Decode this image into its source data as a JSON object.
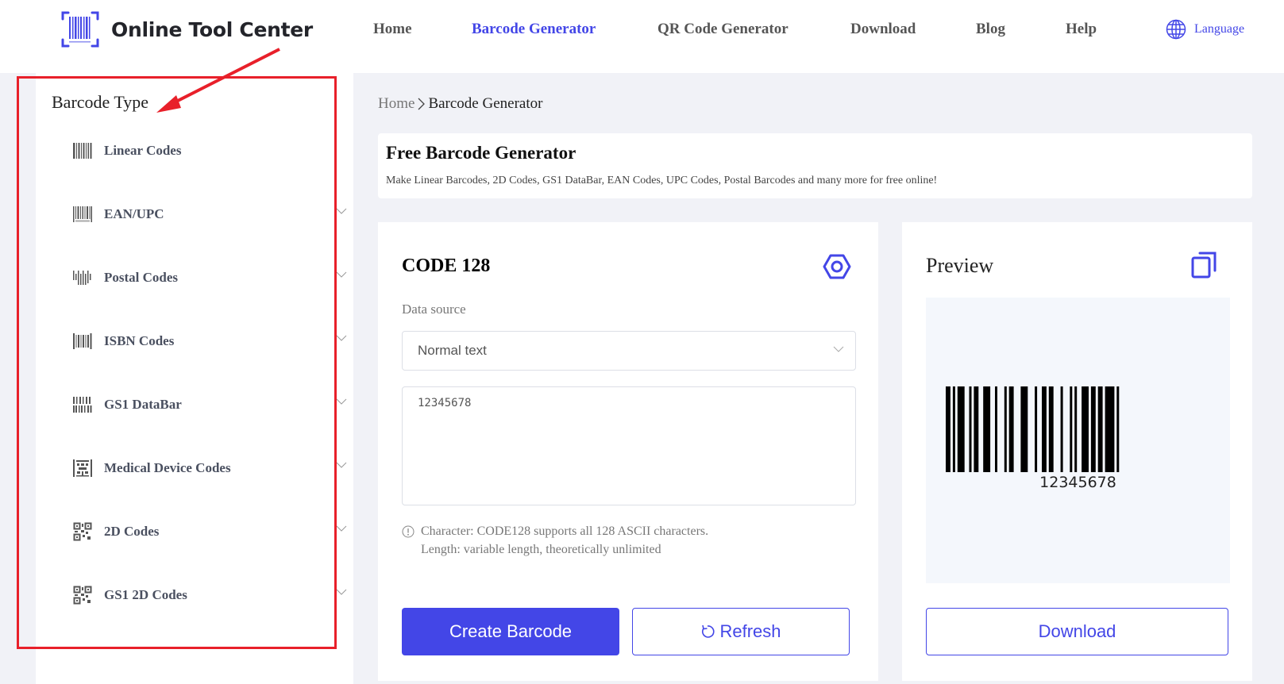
{
  "header": {
    "brand": "Online Tool Center",
    "nav": [
      {
        "label": "Home",
        "active": false
      },
      {
        "label": "Barcode Generator",
        "active": true
      },
      {
        "label": "QR Code Generator",
        "active": false
      },
      {
        "label": "Download",
        "active": false
      },
      {
        "label": "Blog",
        "active": false
      },
      {
        "label": "Help",
        "active": false
      }
    ],
    "language_label": "Language"
  },
  "sidebar": {
    "title": "Barcode Type",
    "items": [
      {
        "label": "Linear Codes",
        "icon": "linear-barcode-icon",
        "expandable": false
      },
      {
        "label": "EAN/UPC",
        "icon": "ean-upc-icon",
        "expandable": true
      },
      {
        "label": "Postal Codes",
        "icon": "postal-barcode-icon",
        "expandable": true
      },
      {
        "label": "ISBN Codes",
        "icon": "isbn-barcode-icon",
        "expandable": true
      },
      {
        "label": "GS1 DataBar",
        "icon": "gs1-databar-icon",
        "expandable": true
      },
      {
        "label": "Medical Device Codes",
        "icon": "medical-code-icon",
        "expandable": true
      },
      {
        "label": "2D Codes",
        "icon": "qr-code-icon",
        "expandable": true
      },
      {
        "label": "GS1 2D Codes",
        "icon": "qr-code-icon",
        "expandable": true
      }
    ]
  },
  "breadcrumb": {
    "home": "Home",
    "separator": ">",
    "current": "Barcode Generator"
  },
  "intro": {
    "title": "Free Barcode Generator",
    "description": "Make Linear Barcodes, 2D Codes, GS1 DataBar, EAN Codes, UPC Codes, Postal Barcodes and many more for free online!"
  },
  "generator": {
    "code_type": "CODE 128",
    "data_source_label": "Data source",
    "data_source_value": "Normal text",
    "input_value": "12345678",
    "hint_line1": "Character: CODE128 supports all 128 ASCII characters.",
    "hint_line2": "Length: variable length, theoretically unlimited",
    "create_label": "Create Barcode",
    "refresh_label": "Refresh"
  },
  "preview": {
    "title": "Preview",
    "barcode_text": "12345678",
    "download_label": "Download"
  },
  "colors": {
    "accent": "#4346e7",
    "highlight": "#e8202a",
    "background": "#f1f2f7"
  }
}
